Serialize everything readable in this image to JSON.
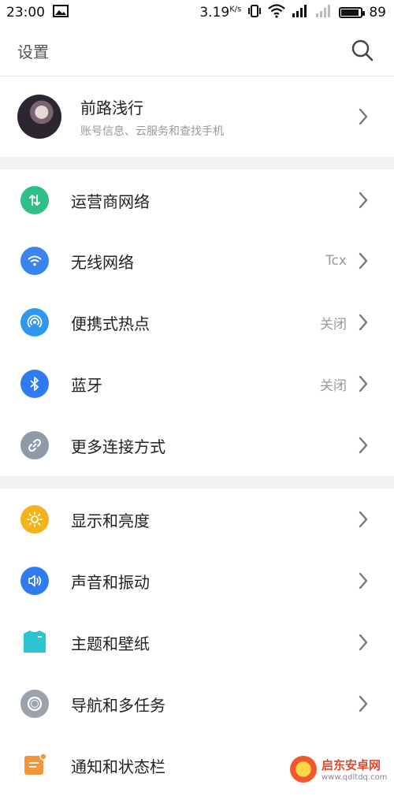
{
  "statusbar": {
    "time": "23:00",
    "speed": "3.19",
    "speed_unit": "K/s",
    "battery": "89"
  },
  "header": {
    "title": "设置"
  },
  "account": {
    "name": "前路浅行",
    "subtitle": "账号信息、云服务和查找手机"
  },
  "sections": {
    "connections": [
      {
        "label": "运营商网络",
        "value": "",
        "icon": "mobile-data-icon",
        "color": "#2fc08a"
      },
      {
        "label": "无线网络",
        "value": "Tcx",
        "icon": "wifi-icon",
        "color": "#3a84f0"
      },
      {
        "label": "便携式热点",
        "value": "关闭",
        "icon": "hotspot-icon",
        "color": "#2e97f0"
      },
      {
        "label": "蓝牙",
        "value": "关闭",
        "icon": "bluetooth-icon",
        "color": "#2f7cf0"
      },
      {
        "label": "更多连接方式",
        "value": "",
        "icon": "link-icon",
        "color": "#8e9aa8"
      }
    ],
    "personalization": [
      {
        "label": "显示和亮度",
        "icon": "brightness-icon",
        "color": "#f6b21b"
      },
      {
        "label": "声音和振动",
        "icon": "sound-icon",
        "color": "#2f7cf0"
      },
      {
        "label": "主题和壁纸",
        "icon": "theme-icon",
        "color": "#2cc4d0"
      },
      {
        "label": "导航和多任务",
        "icon": "navigation-icon",
        "color": "#9aa3ad"
      },
      {
        "label": "通知和状态栏",
        "icon": "notification-icon",
        "color": "#f5953a"
      }
    ]
  },
  "watermark": {
    "text": "启东安卓网",
    "url": "www.qdltdq.com"
  }
}
